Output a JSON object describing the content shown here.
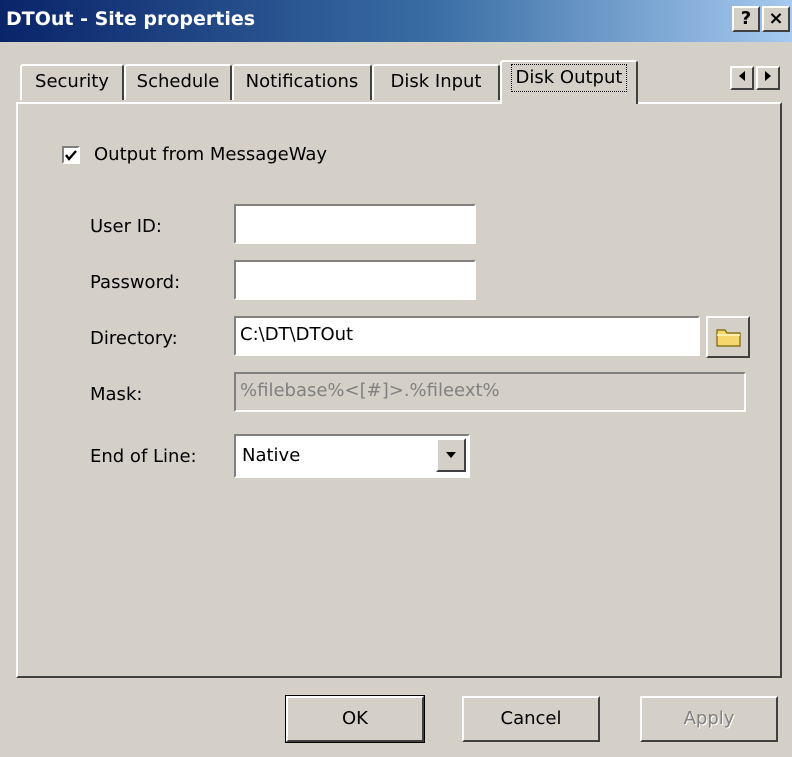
{
  "window": {
    "title": "DTOut - Site properties",
    "help_glyph": "?",
    "close_glyph": "×"
  },
  "tabs": [
    {
      "label": "Security",
      "active": false
    },
    {
      "label": "Schedule",
      "active": false
    },
    {
      "label": "Notifications",
      "active": false
    },
    {
      "label": "Disk Input",
      "active": false
    },
    {
      "label": "Disk Output",
      "active": true
    }
  ],
  "tab_scroll": {
    "left_icon": "arrow-left-icon",
    "right_icon": "arrow-right-icon"
  },
  "form": {
    "output_checkbox": {
      "label": "Output from MessageWay",
      "checked": true
    },
    "user_id": {
      "label": "User ID:",
      "value": ""
    },
    "password": {
      "label": "Password:",
      "value": ""
    },
    "directory": {
      "label": "Directory:",
      "value": "C:\\DT\\DTOut",
      "browse_icon": "folder-icon"
    },
    "mask": {
      "label": "Mask:",
      "value": "%filebase%<[#]>.%fileext%",
      "disabled": true
    },
    "end_of_line": {
      "label": "End of Line:",
      "value": "Native"
    }
  },
  "buttons": {
    "ok": "OK",
    "cancel": "Cancel",
    "apply": "Apply"
  },
  "colors": {
    "face": "#d4d0c8",
    "title_start": "#0a246a",
    "title_end": "#a6caf0",
    "disabled_text": "#808080",
    "folder": "#f5d76e"
  }
}
